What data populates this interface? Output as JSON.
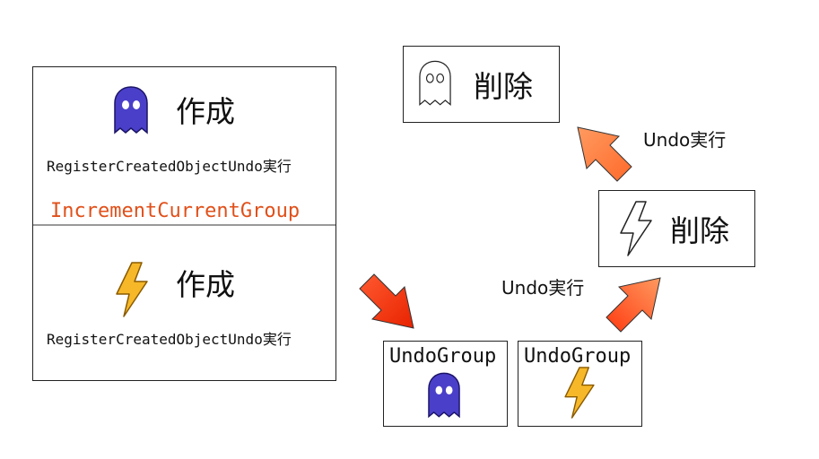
{
  "create_panel": {
    "ghost_create_label": "作成",
    "ghost_register_text": "RegisterCreatedObjectUndo実行",
    "increment_text": "IncrementCurrentGroup",
    "bolt_create_label": "作成",
    "bolt_register_text": "RegisterCreatedObjectUndo実行"
  },
  "undo_groups": [
    {
      "title": "UndoGroup",
      "icon": "ghost-icon"
    },
    {
      "title": "UndoGroup",
      "icon": "lightning-icon"
    }
  ],
  "delete_boxes": {
    "bolt_delete_label": "削除",
    "ghost_delete_label": "削除"
  },
  "undo_labels": {
    "first": "Undo実行",
    "second": "Undo実行"
  },
  "colors": {
    "ghost": "#4a3fc9",
    "bolt": "#f6b829",
    "increment_text": "#e0501a",
    "arrow_red": "#ff3311",
    "arrow_orange": "#ff8c4a"
  }
}
